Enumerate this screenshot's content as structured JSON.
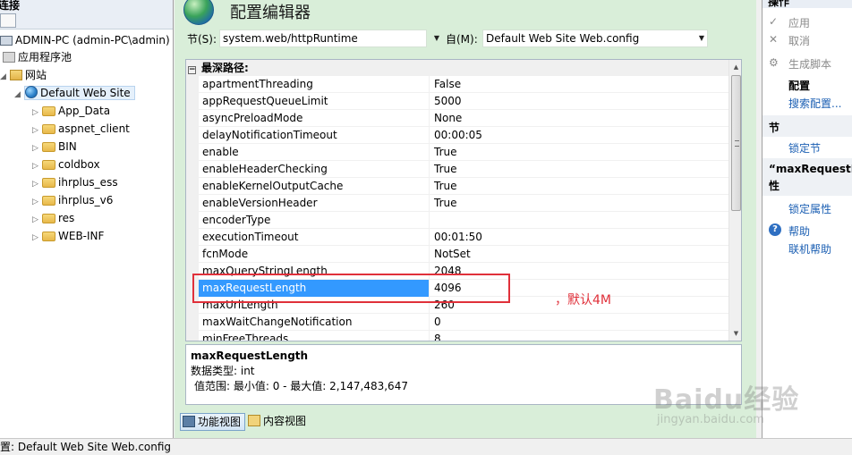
{
  "left_panel": {
    "title": "连接",
    "tree": [
      {
        "label": "ADMIN-PC (admin-PC\\admin)",
        "level": 0,
        "icon": "computer-icon"
      },
      {
        "label": "应用程序池",
        "level": 1,
        "icon": "app-pool-icon"
      },
      {
        "label": "网站",
        "level": 1,
        "icon": "sites-folder-icon"
      },
      {
        "label": "Default Web Site",
        "level": 2,
        "icon": "globe-icon",
        "selected": true
      },
      {
        "label": "App_Data",
        "level": 3,
        "icon": "folder-icon"
      },
      {
        "label": "aspnet_client",
        "level": 3,
        "icon": "folder-icon"
      },
      {
        "label": "BIN",
        "level": 3,
        "icon": "folder-icon"
      },
      {
        "label": "coldbox",
        "level": 3,
        "icon": "folder-icon"
      },
      {
        "label": "ihrplus_ess",
        "level": 3,
        "icon": "folder-icon"
      },
      {
        "label": "ihrplus_v6",
        "level": 3,
        "icon": "folder-icon"
      },
      {
        "label": "res",
        "level": 3,
        "icon": "folder-icon"
      },
      {
        "label": "WEB-INF",
        "level": 3,
        "icon": "folder-icon"
      }
    ]
  },
  "center": {
    "title": "配置编辑器",
    "section_label": "节(S):",
    "section_value": "system.web/httpRuntime",
    "from_label": "自(M):",
    "from_value": "Default Web Site Web.config",
    "category": "最深路径:",
    "properties": [
      {
        "name": "apartmentThreading",
        "value": "False"
      },
      {
        "name": "appRequestQueueLimit",
        "value": "5000"
      },
      {
        "name": "asyncPreloadMode",
        "value": "None"
      },
      {
        "name": "delayNotificationTimeout",
        "value": "00:00:05"
      },
      {
        "name": "enable",
        "value": "True"
      },
      {
        "name": "enableHeaderChecking",
        "value": "True"
      },
      {
        "name": "enableKernelOutputCache",
        "value": "True"
      },
      {
        "name": "enableVersionHeader",
        "value": "True"
      },
      {
        "name": "encoderType",
        "value": ""
      },
      {
        "name": "executionTimeout",
        "value": "00:01:50"
      },
      {
        "name": "fcnMode",
        "value": "NotSet"
      },
      {
        "name": "maxQueryStringLength",
        "value": "2048"
      },
      {
        "name": "maxRequestLength",
        "value": "4096",
        "selected": true
      },
      {
        "name": "maxUrlLength",
        "value": "260"
      },
      {
        "name": "maxWaitChangeNotification",
        "value": "0"
      },
      {
        "name": "minFreeThreads",
        "value": "8"
      }
    ],
    "description": {
      "title": "maxRequestLength",
      "type_line": "数据类型: int",
      "range_line": "值范围: 最小值: 0 - 最大值: 2,147,483,647"
    },
    "view_tabs": [
      {
        "label": "功能视图",
        "active": true
      },
      {
        "label": "内容视图",
        "active": false
      }
    ],
    "annotation": "，默认4M"
  },
  "right_panel": {
    "title": "操作",
    "apply": "应用",
    "cancel": "取消",
    "generate_script": "生成脚本",
    "config_heading": "配置",
    "search_config": "搜索配置...",
    "section_heading": "节",
    "lock_section": "锁定节",
    "prop_heading_1": "“maxRequestL",
    "prop_heading_2": "性",
    "lock_attribute": "锁定属性",
    "help": "帮助",
    "online_help": "联机帮助"
  },
  "status_bar": {
    "text": "配置: Default Web Site Web.config"
  },
  "watermark": {
    "line1": "Baidu经验",
    "line2": "jingyan.baidu.com"
  },
  "colors": {
    "center_bg": "#d9eed9",
    "selection": "#3399ff",
    "highlight_red": "#e0303a",
    "link_blue": "#1b5fb3"
  }
}
